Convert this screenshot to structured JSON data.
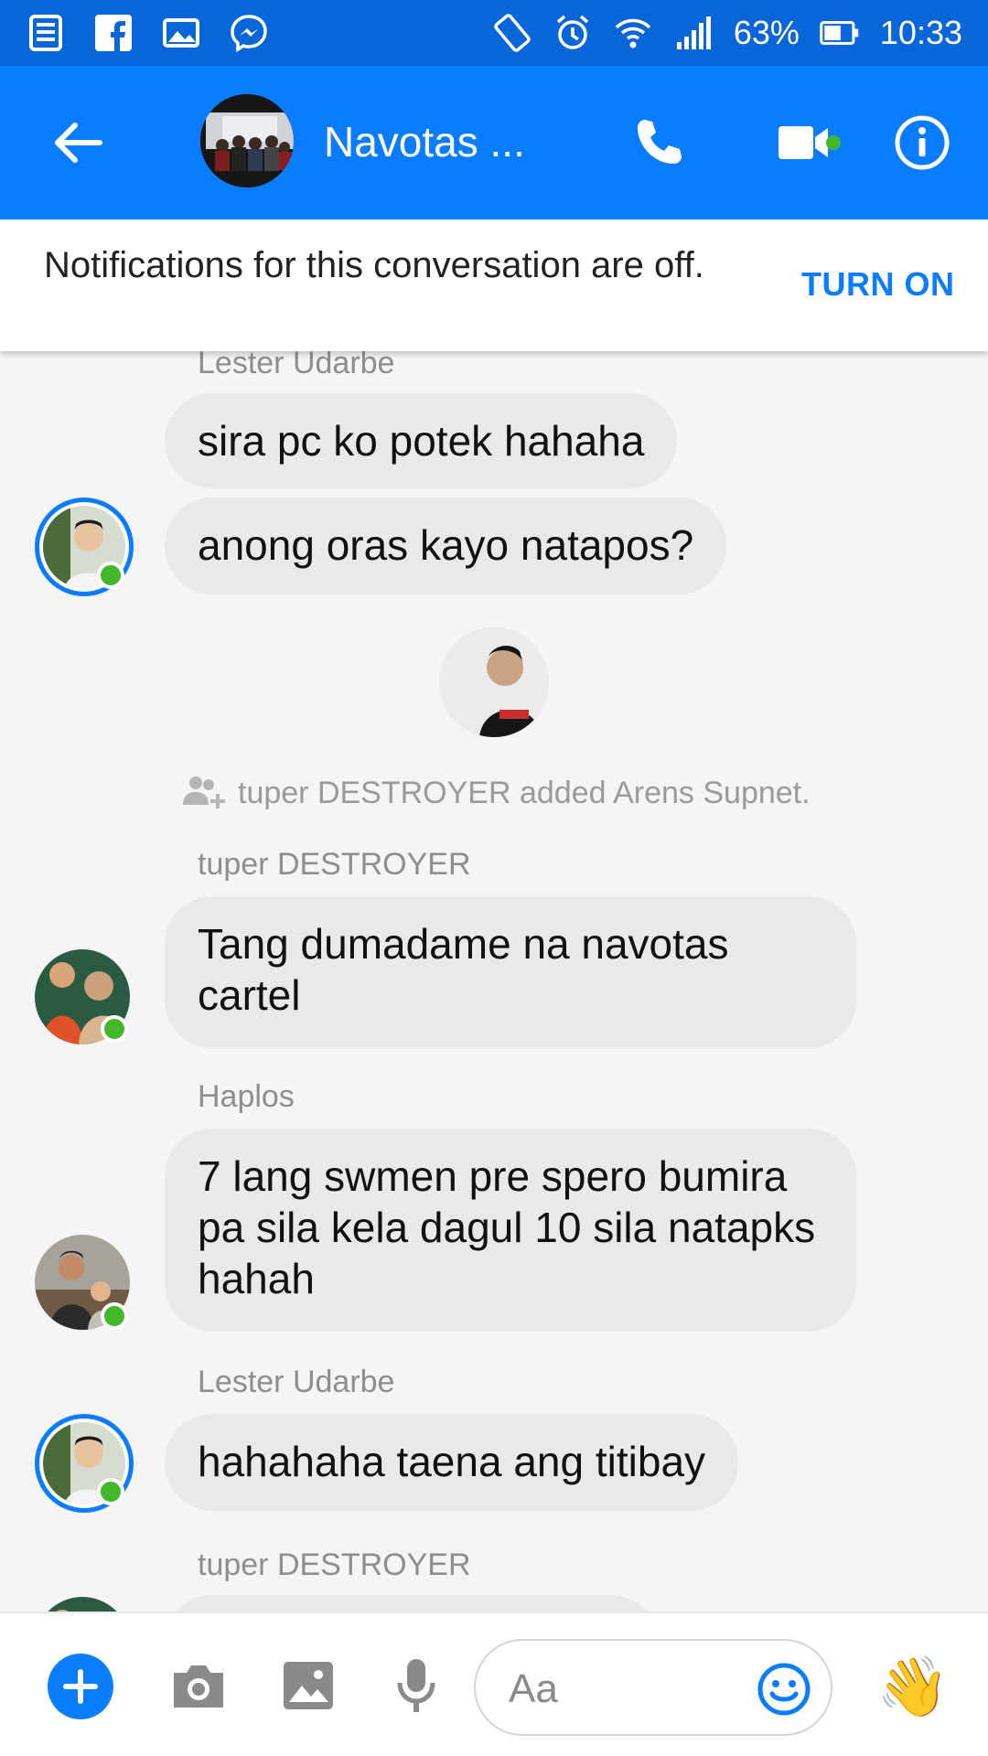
{
  "status_bar": {
    "battery": "63%",
    "time": "10:33"
  },
  "header": {
    "title": "Navotas ...",
    "back_icon": "arrow-left-icon",
    "call_icon": "phone-icon",
    "video_icon": "video-camera-icon",
    "info_icon": "info-icon"
  },
  "notification": {
    "text": "Notifications for this conversation are off.",
    "action": "TURN ON"
  },
  "messages": [
    {
      "sender": "Lester Udarbe",
      "text": "sira pc ko potek hahaha"
    },
    {
      "sender": "",
      "text": "anong oras kayo natapos?"
    },
    {
      "sender": "tuper DESTROYER",
      "text": "Tang dumadame na navotas cartel"
    },
    {
      "sender": "Haplos",
      "text": "7 lang swmen pre spero bumira pa sila kela dagul 10 sila natapks hahah"
    },
    {
      "sender": "Lester Udarbe",
      "text": "hahahaha taena ang titibay"
    },
    {
      "sender": "tuper DESTROYER",
      "text": ""
    }
  ],
  "system_event": {
    "text": "tuper DESTROYER added Arens Supnet."
  },
  "composer": {
    "placeholder": "Aa"
  },
  "colors": {
    "accent": "#0a7cff",
    "status_bar": "#0866d8",
    "bubble": "#e9e9e9",
    "online": "#42b72a"
  }
}
